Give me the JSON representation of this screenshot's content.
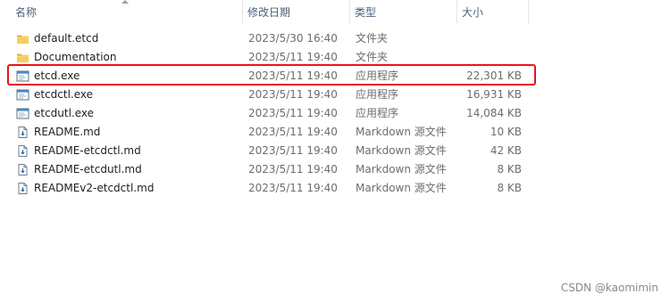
{
  "columns": {
    "name": "名称",
    "date": "修改日期",
    "type": "类型",
    "size": "大小"
  },
  "files": [
    {
      "name": "default.etcd",
      "date": "2023/5/30 16:40",
      "type": "文件夹",
      "size": "",
      "icon": "folder-icon"
    },
    {
      "name": "Documentation",
      "date": "2023/5/11 19:40",
      "type": "文件夹",
      "size": "",
      "icon": "folder-icon"
    },
    {
      "name": "etcd.exe",
      "date": "2023/5/11 19:40",
      "type": "应用程序",
      "size": "22,301 KB",
      "icon": "exe-icon",
      "highlighted": true
    },
    {
      "name": "etcdctl.exe",
      "date": "2023/5/11 19:40",
      "type": "应用程序",
      "size": "16,931 KB",
      "icon": "exe-icon"
    },
    {
      "name": "etcdutl.exe",
      "date": "2023/5/11 19:40",
      "type": "应用程序",
      "size": "14,084 KB",
      "icon": "exe-icon"
    },
    {
      "name": "README.md",
      "date": "2023/5/11 19:40",
      "type": "Markdown 源文件",
      "size": "10 KB",
      "icon": "markdown-file-icon"
    },
    {
      "name": "README-etcdctl.md",
      "date": "2023/5/11 19:40",
      "type": "Markdown 源文件",
      "size": "42 KB",
      "icon": "markdown-file-icon"
    },
    {
      "name": "README-etcdutl.md",
      "date": "2023/5/11 19:40",
      "type": "Markdown 源文件",
      "size": "8 KB",
      "icon": "markdown-file-icon"
    },
    {
      "name": "READMEv2-etcdctl.md",
      "date": "2023/5/11 19:40",
      "type": "Markdown 源文件",
      "size": "8 KB",
      "icon": "markdown-file-icon"
    }
  ],
  "watermark": "CSDN @kaomimin",
  "colors": {
    "highlight": "#e8151b",
    "folder": "#f2c14b",
    "header_text": "#4c607a"
  }
}
